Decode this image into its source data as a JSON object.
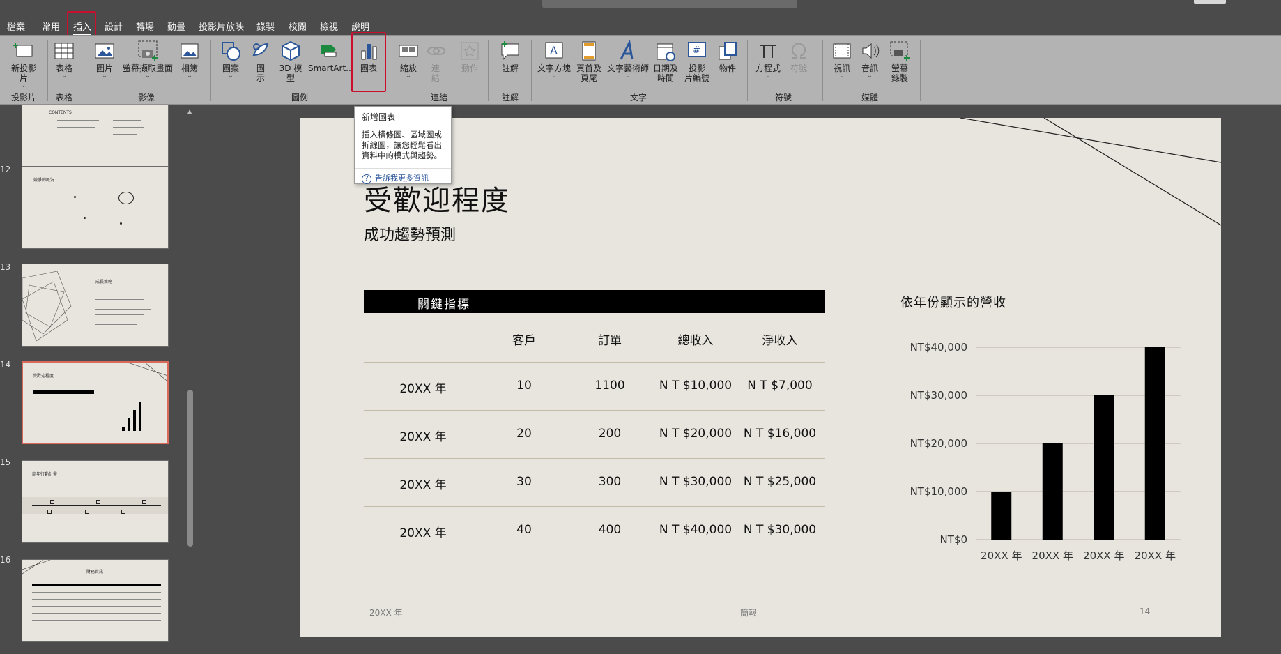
{
  "menu": {
    "tabs": [
      "檔案",
      "常用",
      "插入",
      "設計",
      "轉場",
      "動畫",
      "投影片放映",
      "錄製",
      "校閱",
      "檢視",
      "說明"
    ],
    "active_index": 2
  },
  "ribbon": {
    "buttons": {
      "new_slide": "新投影\n片",
      "table": "表格",
      "pictures": "圖片",
      "screenshot": "螢幕擷取畫面",
      "album": "相簿",
      "shapes": "圖案",
      "icons": "圖\n示",
      "model3d": "3D 模\n型",
      "smartart": "SmartArt...",
      "chart": "圖表",
      "zoom": "縮放",
      "link": "連\n結",
      "action": "動作",
      "comment": "註解",
      "textbox": "文字方塊",
      "header_footer": "頁首及\n頁尾",
      "wordart": "文字藝術師",
      "datetime": "日期及\n時間",
      "slide_number": "投影\n片編號",
      "object": "物件",
      "equation": "方程式",
      "symbol": "符號",
      "video": "視訊",
      "audio": "音訊",
      "screen_recording": "螢幕\n錄製"
    },
    "groups": {
      "slides": "投影片",
      "tables": "表格",
      "images": "影像",
      "illustrations": "圖例",
      "links": "連結",
      "comments": "註解",
      "text": "文字",
      "symbols": "符號",
      "media": "媒體"
    }
  },
  "tooltip": {
    "title": "新增圖表",
    "body": "插入橫條圖、區域圖或折線圖，讓您輕鬆看出資料中的模式與趨勢。",
    "link": "告訴我更多資訊"
  },
  "thumbnails": {
    "numbers": [
      "12",
      "13",
      "14",
      "15",
      "16"
    ]
  },
  "slide": {
    "title": "受歡迎程度",
    "subtitle": "成功趨勢預測",
    "kpi_header": "關鍵指標",
    "table": {
      "columns": [
        "客戶",
        "訂單",
        "總收入",
        "淨收入"
      ],
      "rows": [
        [
          "20XX 年",
          "10",
          "1100",
          "N T $10,000",
          "N T $7,000"
        ],
        [
          "20XX 年",
          "20",
          "200",
          "N T $20,000",
          "N T $16,000"
        ],
        [
          "20XX 年",
          "30",
          "300",
          "N T $30,000",
          "N T $25,000"
        ],
        [
          "20XX 年",
          "40",
          "400",
          "N T $40,000",
          "N T $30,000"
        ]
      ]
    },
    "footer": {
      "left": "20XX 年",
      "center": "簡報",
      "page": "14"
    }
  },
  "chart_data": {
    "type": "bar",
    "title": "依年份顯示的營收",
    "categories": [
      "20XX 年",
      "20XX 年",
      "20XX 年",
      "20XX 年"
    ],
    "values": [
      10000,
      20000,
      30000,
      40000
    ],
    "yticks": [
      "NT$0",
      "NT$10,000",
      "NT$20,000",
      "NT$30,000",
      "NT$40,000"
    ],
    "ylim": [
      0,
      40000
    ],
    "grid": true,
    "bar_color": "#000000"
  },
  "colors": {
    "highlight": "#c8102e",
    "ribbon": "#b3b3b3",
    "background": "#4b4b4b",
    "slide": "#e8e5df"
  }
}
